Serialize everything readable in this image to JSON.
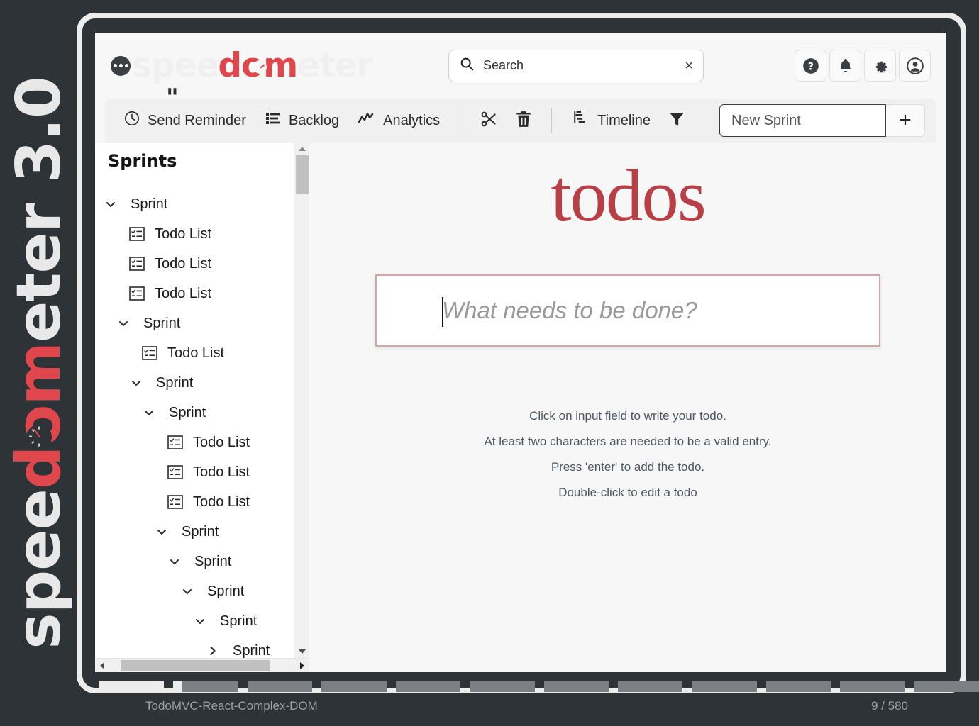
{
  "watermark": {
    "pre": "spee",
    "accent": "dom",
    "post": "eter 3.0"
  },
  "header": {
    "brand": {
      "pre": "spee",
      "accent": "dom",
      "post": "eter",
      "quote": "\""
    },
    "search": {
      "placeholder": "Search",
      "value": "",
      "clear_label": "×"
    },
    "actions": [
      {
        "name": "help-icon",
        "label": "Help"
      },
      {
        "name": "bell-icon",
        "label": "Notifications"
      },
      {
        "name": "gear-icon",
        "label": "Settings"
      },
      {
        "name": "user-icon",
        "label": "Account"
      }
    ]
  },
  "toolbar": {
    "items": [
      {
        "icon": "clock-icon",
        "label": "Send Reminder"
      },
      {
        "icon": "list-icon",
        "label": "Backlog"
      },
      {
        "icon": "analytics-icon",
        "label": "Analytics"
      }
    ],
    "icon_buttons": [
      {
        "icon": "scissors-icon",
        "label": "Cut"
      },
      {
        "icon": "trash-icon",
        "label": "Delete"
      }
    ],
    "timeline": {
      "icon": "timeline-icon",
      "label": "Timeline"
    },
    "filter": {
      "icon": "filter-icon",
      "label": "Filter"
    },
    "new_sprint": {
      "value": "New Sprint",
      "placeholder": "New Sprint",
      "add_label": "+"
    }
  },
  "sidebar": {
    "title": "Sprints",
    "tree": [
      {
        "depth": 0,
        "type": "sprint",
        "state": "expanded",
        "label": "Sprint"
      },
      {
        "depth": 1,
        "type": "todo",
        "state": "leaf",
        "label": "Todo List"
      },
      {
        "depth": 1,
        "type": "todo",
        "state": "leaf",
        "label": "Todo List"
      },
      {
        "depth": 1,
        "type": "todo",
        "state": "leaf",
        "label": "Todo List"
      },
      {
        "depth": 1,
        "type": "sprint",
        "state": "expanded",
        "label": "Sprint"
      },
      {
        "depth": 2,
        "type": "todo",
        "state": "leaf",
        "label": "Todo List"
      },
      {
        "depth": 2,
        "type": "sprint",
        "state": "expanded",
        "label": "Sprint"
      },
      {
        "depth": 3,
        "type": "sprint",
        "state": "expanded",
        "label": "Sprint"
      },
      {
        "depth": 4,
        "type": "todo",
        "state": "leaf",
        "label": "Todo List"
      },
      {
        "depth": 4,
        "type": "todo",
        "state": "leaf",
        "label": "Todo List"
      },
      {
        "depth": 4,
        "type": "todo",
        "state": "leaf",
        "label": "Todo List"
      },
      {
        "depth": 4,
        "type": "sprint",
        "state": "expanded",
        "label": "Sprint"
      },
      {
        "depth": 5,
        "type": "sprint",
        "state": "expanded",
        "label": "Sprint"
      },
      {
        "depth": 6,
        "type": "sprint",
        "state": "expanded",
        "label": "Sprint"
      },
      {
        "depth": 7,
        "type": "sprint",
        "state": "expanded",
        "label": "Sprint"
      },
      {
        "depth": 8,
        "type": "sprint",
        "state": "collapsed",
        "label": "Sprint"
      }
    ]
  },
  "main": {
    "title": "todos",
    "new_todo_placeholder": "What needs to be done?",
    "new_todo_value": "",
    "hints": [
      "Click on input field to write your todo.",
      "At least two characters are needed to be a valid entry.",
      "Press 'enter' to add the todo.",
      "Double-click to edit a todo"
    ]
  },
  "status": {
    "benchmark": "TodoMVC-React-Complex-DOM",
    "progress_label": "9 / 580",
    "segments": [
      100,
      14,
      0,
      0,
      0,
      0,
      0,
      0,
      0,
      0,
      0,
      0
    ]
  },
  "colors": {
    "accent": "#e0474c",
    "todos_red": "#b83f45",
    "window_bg": "#f7f7f7",
    "page_bg": "#2e3338",
    "frame": "#ececec"
  }
}
